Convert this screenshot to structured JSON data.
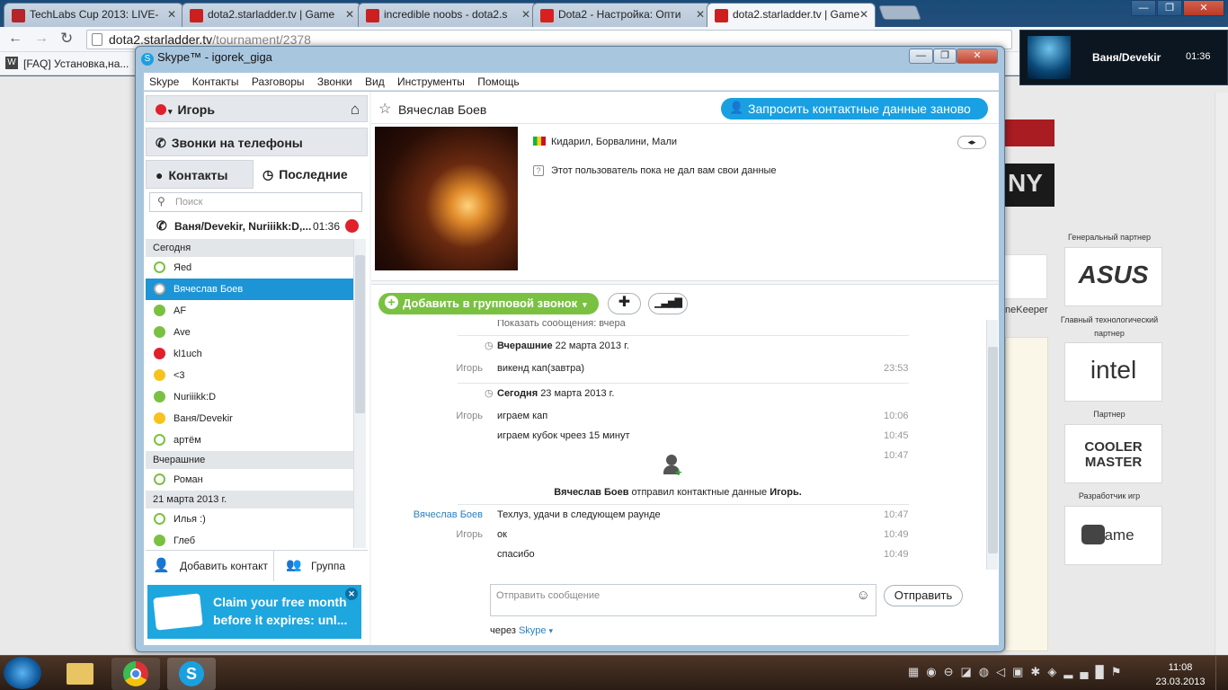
{
  "browser": {
    "tabs": [
      {
        "label": "TechLabs Cup 2013: LIVE-",
        "fav_color": "#b5252a"
      },
      {
        "label": "dota2.starladder.tv | Game",
        "fav_color": "#cc2020"
      },
      {
        "label": "incredible noobs - dota2.s",
        "fav_color": "#cc2020"
      },
      {
        "label": "Dota2 - Настройка: Опти",
        "fav_color": "#d82020"
      },
      {
        "label": "dota2.starladder.tv | Game",
        "fav_color": "#cc2020"
      }
    ],
    "url_host": "dota2.starladder.tv",
    "url_path": "/tournament/2378",
    "bookmark": "[FAQ] Установка,на...",
    "page_fragments": {
      "keeper": "neKeeper",
      "ny": "NY"
    }
  },
  "skype": {
    "title": "Skype™ - igorek_giga",
    "menu": [
      "Skype",
      "Контакты",
      "Разговоры",
      "Звонки",
      "Вид",
      "Инструменты",
      "Помощь"
    ],
    "my_name": "Игорь",
    "phones": "Звонки на телефоны",
    "tab_contacts": "Контакты",
    "tab_recent": "Последние",
    "search_placeholder": "Поиск",
    "call": {
      "name": "Ваня/Devekir, Nuriiikk:D,...",
      "time": "01:36"
    },
    "list": [
      {
        "type": "hdr",
        "label": "Сегодня"
      },
      {
        "type": "item",
        "label": "Яed",
        "status": "off"
      },
      {
        "type": "item",
        "label": "Вячеслав Боев",
        "status": "unk",
        "selected": true
      },
      {
        "type": "item",
        "label": "AF",
        "status": "on"
      },
      {
        "type": "item",
        "label": "Ave",
        "status": "on"
      },
      {
        "type": "item",
        "label": "kl1uch",
        "status": "dnd"
      },
      {
        "type": "item",
        "label": "<3",
        "status": "away"
      },
      {
        "type": "item",
        "label": "Nuriiikk:D",
        "status": "on"
      },
      {
        "type": "item",
        "label": "Ваня/Devekir",
        "status": "away"
      },
      {
        "type": "item",
        "label": "артём",
        "status": "off"
      },
      {
        "type": "hdr",
        "label": "Вчерашние"
      },
      {
        "type": "item",
        "label": "Роман",
        "status": "off"
      },
      {
        "type": "hdr",
        "label": "21 марта 2013 г."
      },
      {
        "type": "item",
        "label": "Илья :)",
        "status": "off"
      },
      {
        "type": "item",
        "label": "Глеб",
        "status": "on"
      }
    ],
    "add_contact": "Добавить контакт",
    "group": "Группа",
    "promo": "Claim your free month before it expires: unl...",
    "profile": {
      "name": "Вячеслав Боев",
      "request_button": "Запросить контактные данные заново",
      "location": "Кидарил, Борвалини, Мали",
      "notice": "Этот пользователь пока не дал вам свои данные"
    },
    "add_group_call": "Добавить в групповой звонок",
    "chat": {
      "cut_line": "Показать сообщения: вчера",
      "day1_label": "Вчерашние",
      "day1_date": "22 марта 2013 г.",
      "day2_label": "Сегодня",
      "day2_date": "23 марта 2013 г.",
      "messages": [
        {
          "who": "Игорь",
          "text": "викенд кап(завтра)",
          "time": "23:53"
        },
        {
          "who": "Игорь",
          "text": "играем кап",
          "time": "10:06"
        },
        {
          "who": "",
          "text": "играем кубок чреез 15 минут",
          "time": "10:45"
        },
        {
          "who": "",
          "text": "",
          "time": "10:47"
        },
        {
          "who": "Вячеслав Боев",
          "text": "Техлуз, удачи в следующем раунде",
          "time": "10:47"
        },
        {
          "who": "Игорь",
          "text": "ок",
          "time": "10:49"
        },
        {
          "who": "",
          "text": "спасибо",
          "time": "10:49"
        }
      ],
      "contact_sent_name": "Вячеслав Боев",
      "contact_sent_mid": "отправил контактные данные",
      "contact_sent_to": "Игорь."
    },
    "input_placeholder": "Отправить сообщение",
    "send": "Отправить",
    "via": "через",
    "via_link": "Skype"
  },
  "site": {
    "partners": [
      {
        "label": "Генеральный партнер",
        "logo": "ASUS"
      },
      {
        "label": "Главный технологический партнер",
        "logo": "intel"
      },
      {
        "label": "Партнер",
        "logo": "COOLER MASTER"
      },
      {
        "label": "Разработчик игр",
        "logo": "game"
      }
    ]
  },
  "notification": {
    "name": "Ваня/Devekir",
    "time": "01:36"
  },
  "taskbar": {
    "time": "11:08",
    "date": "23.03.2013"
  }
}
